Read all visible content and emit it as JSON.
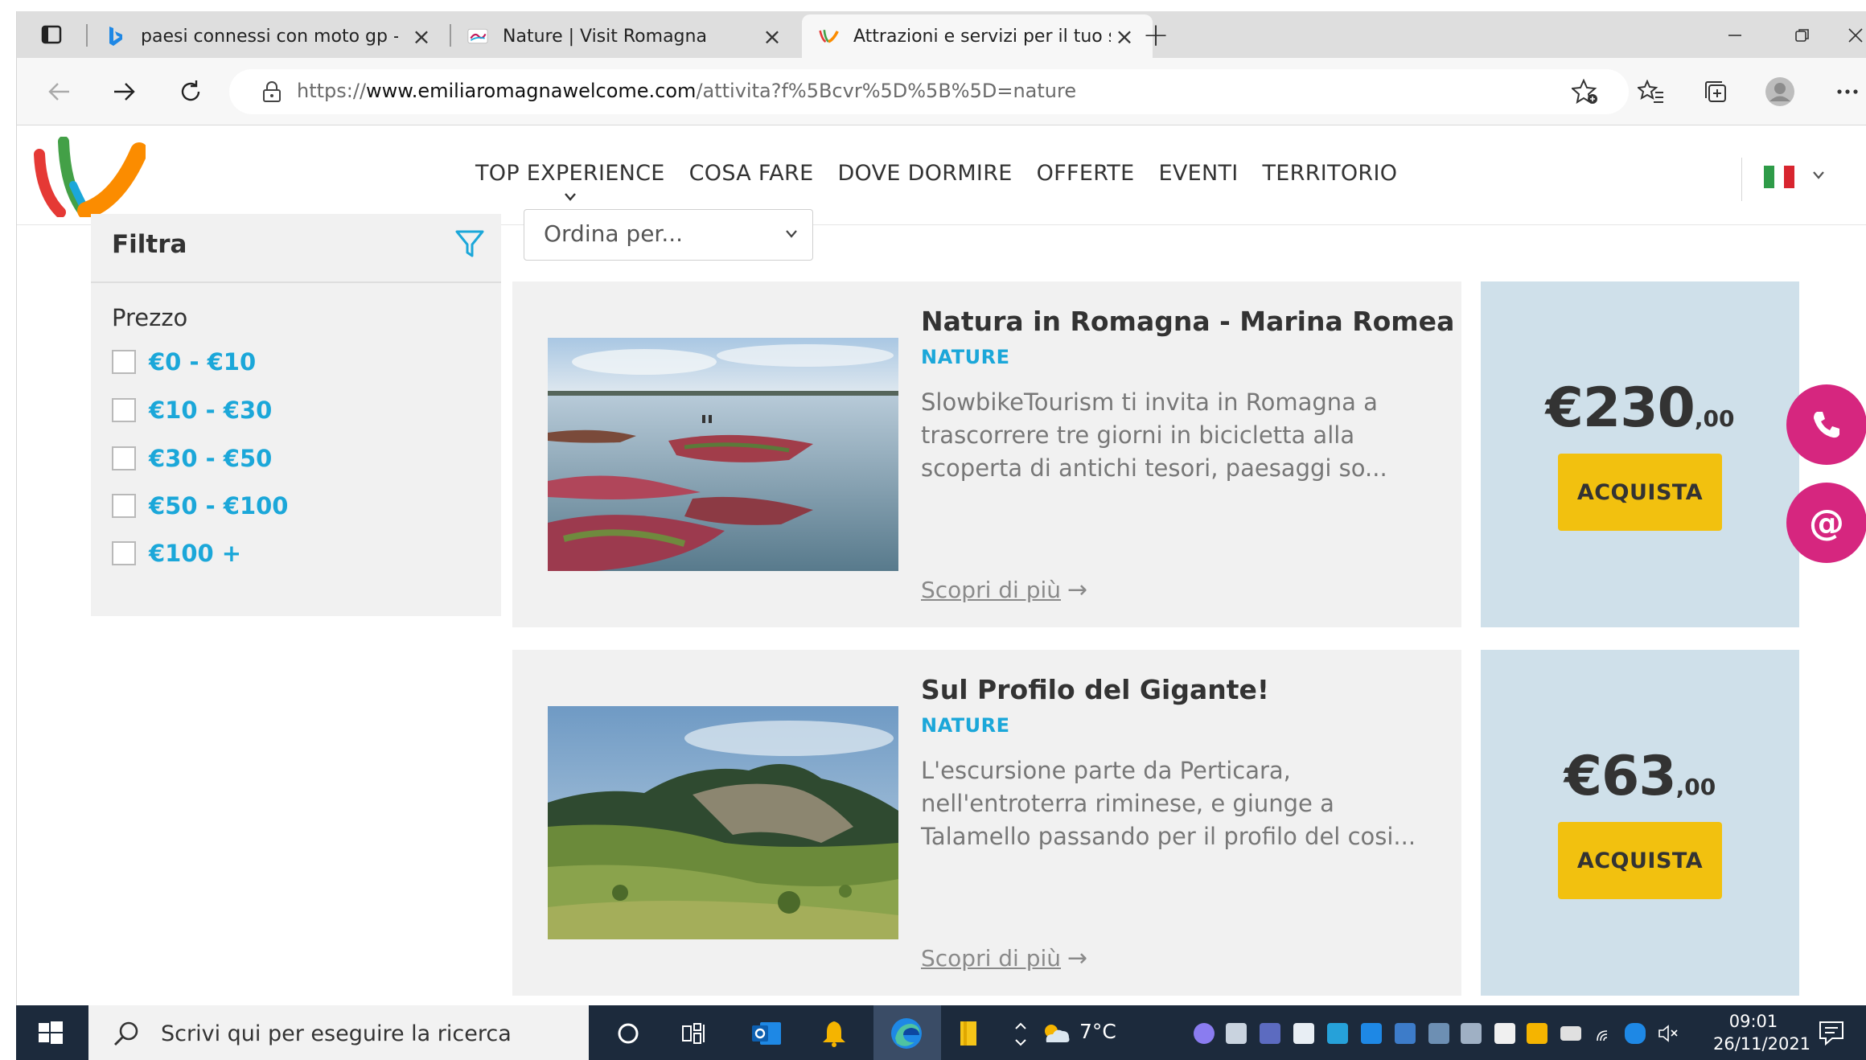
{
  "browser": {
    "tabs": [
      {
        "title": "paesi connessi con moto gp - Bi",
        "icon": "bing-icon"
      },
      {
        "title": "Nature | Visit Romagna",
        "icon": "visit-romagna-icon"
      },
      {
        "title": "Attrazioni e servizi per il tuo sog",
        "icon": "emilia-romagna-icon"
      }
    ],
    "url": {
      "scheme": "https://",
      "host": "www.emiliaromagnawelcome.com",
      "path": "/attivita?f%5Bcvr%5D%5B%5D=nature"
    }
  },
  "site": {
    "nav": [
      "TOP EXPERIENCE",
      "COSA FARE",
      "DOVE DORMIRE",
      "OFFERTE",
      "EVENTI",
      "TERRITORIO"
    ],
    "language_flag": "it-flag-icon"
  },
  "filter": {
    "title": "Filtra",
    "price_title": "Prezzo",
    "options": [
      "€0 - €10",
      "€10 - €30",
      "€30 - €50",
      "€50 - €100",
      "€100 +"
    ]
  },
  "sort": {
    "value": "Ordina per..."
  },
  "results": [
    {
      "title": "Natura in Romagna - Marina Romea",
      "category": "NATURE",
      "description": "SlowbikeTourism ti invita in Romagna a trascorrere tre giorni in bicicletta alla scoperta di antichi tesori, paesaggi so...",
      "more": "Scopri di più",
      "price_main": "€230",
      "price_cents": ",00",
      "buy": "ACQUISTA"
    },
    {
      "title": "Sul Profilo del Gigante!",
      "category": "NATURE",
      "description": "L'escursione parte da Perticara, nell'entroterra riminese, e giunge a Talamello passando per il profilo del cosi...",
      "more": "Scopri di più",
      "price_main": "€63",
      "price_cents": ",00",
      "buy": "ACQUISTA"
    }
  ],
  "taskbar": {
    "search_placeholder": "Scrivi qui per eseguire la ricerca",
    "weather": "7°C",
    "time": "09:01",
    "date": "26/11/2021"
  },
  "colors": {
    "accent_blue": "#1ba7d9",
    "price_bg": "#cfe0ea",
    "buy_button": "#f2c10f",
    "fab": "#d6267f",
    "taskbar": "#1c2a3c"
  }
}
